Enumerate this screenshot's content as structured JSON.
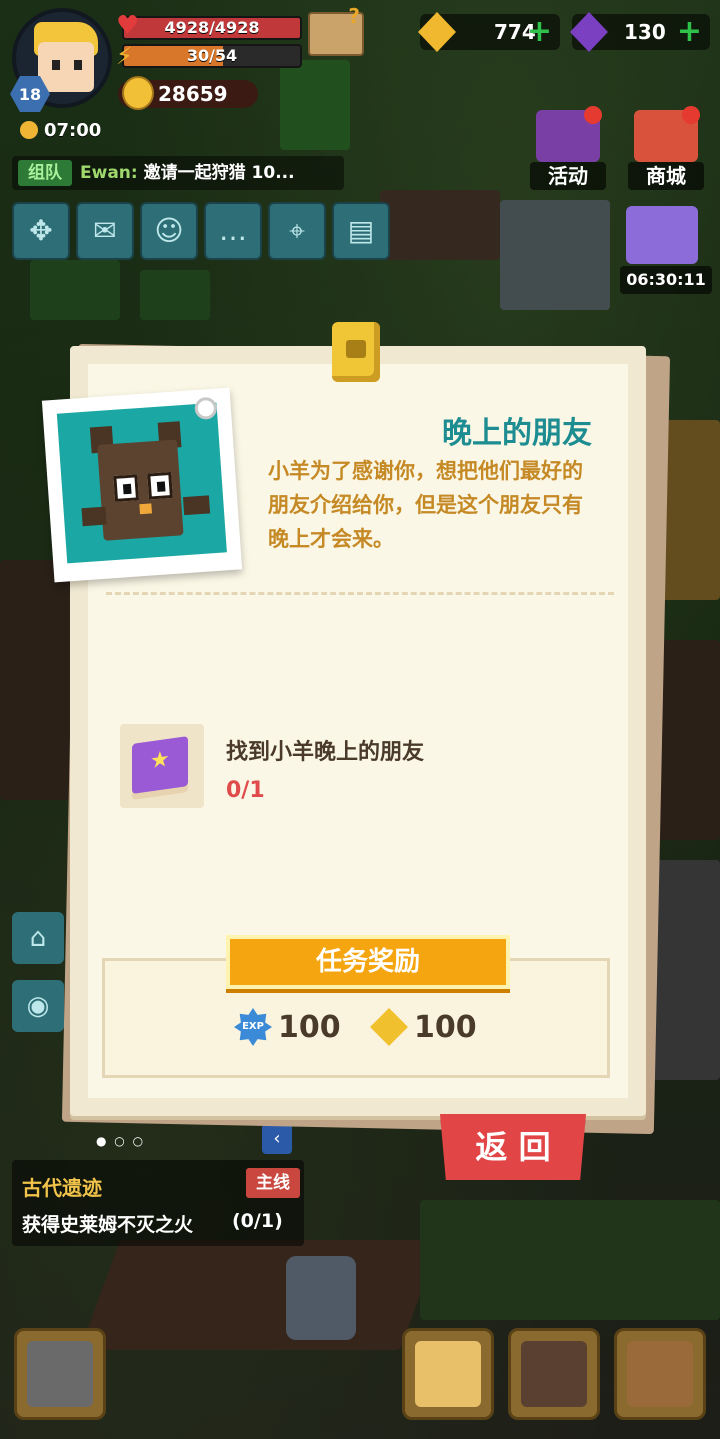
{
  "hud": {
    "level": "18",
    "hp": "4928/4928",
    "energy_current": "30",
    "energy_sep": "/",
    "energy_max": "54",
    "power": "28659",
    "time": "07:00",
    "gold": "774",
    "gems": "130"
  },
  "chat": {
    "tag": "组队",
    "name": "Ewan:",
    "message": "邀请一起狩猎 10..."
  },
  "events": {
    "activity_label": "活动",
    "shop_label": "商城",
    "timer": "06:30:11"
  },
  "quest": {
    "title": "晚上的朋友",
    "description": "小羊为了感谢你，想把他们最好的朋友介绍给你，但是这个朋友只有晚上才会来。",
    "objective": "找到小羊晚上的朋友",
    "progress": "0/1",
    "reward_header": "任务奖励",
    "reward_exp_icon_text": "EXP",
    "reward_exp": "100",
    "reward_gold": "100",
    "back_label": "返 回"
  },
  "tracker": {
    "title": "古代遗迹",
    "tag": "主线",
    "task": "获得史莱姆不灭之火",
    "progress": "(0/1)"
  },
  "icons": {
    "menu": [
      "expand-icon",
      "mail-icon",
      "friends-icon",
      "chat-icon",
      "map-icon",
      "quest-board-icon"
    ]
  }
}
